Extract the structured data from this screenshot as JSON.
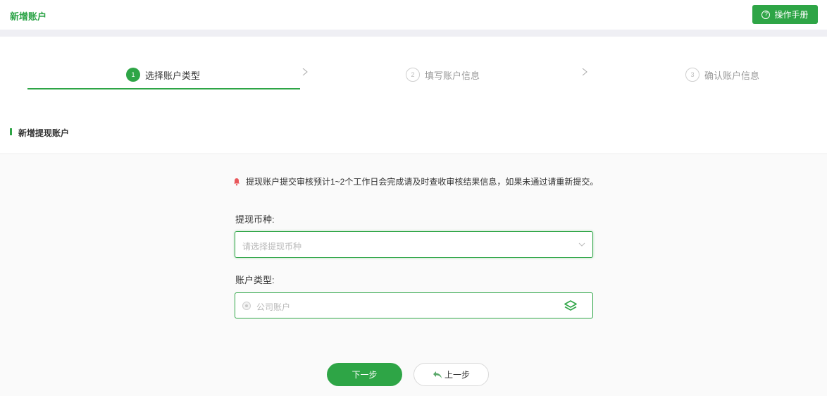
{
  "header": {
    "title": "新增账户",
    "manual_button": "操作手册",
    "help_icon_glyph": "?"
  },
  "steps": [
    {
      "number": "1",
      "label": "选择账户类型",
      "state": "active"
    },
    {
      "number": "2",
      "label": "填写账户信息",
      "state": "inactive"
    },
    {
      "number": "3",
      "label": "确认账户信息",
      "state": "inactive"
    }
  ],
  "section": {
    "title": "新增提现账户"
  },
  "form": {
    "notice": "提现账户提交审核预计1~2个工作日会完成请及时查收审核结果信息，如果未通过请重新提交。",
    "currency_label": "提现币种:",
    "currency_placeholder": "请选择提现币种",
    "account_type_label": "账户类型:",
    "account_type_option": "公司账户"
  },
  "actions": {
    "next": "下一步",
    "prev": "上一步"
  },
  "colors": {
    "accent": "#2ea546",
    "notice_icon": "#e9575b"
  },
  "icons": {
    "help": "question-circle-icon",
    "chevron": "chevron-right-icon",
    "bell": "bell-icon",
    "dropdown": "chevron-down-icon",
    "layers": "layers-icon",
    "back": "reply-icon"
  }
}
